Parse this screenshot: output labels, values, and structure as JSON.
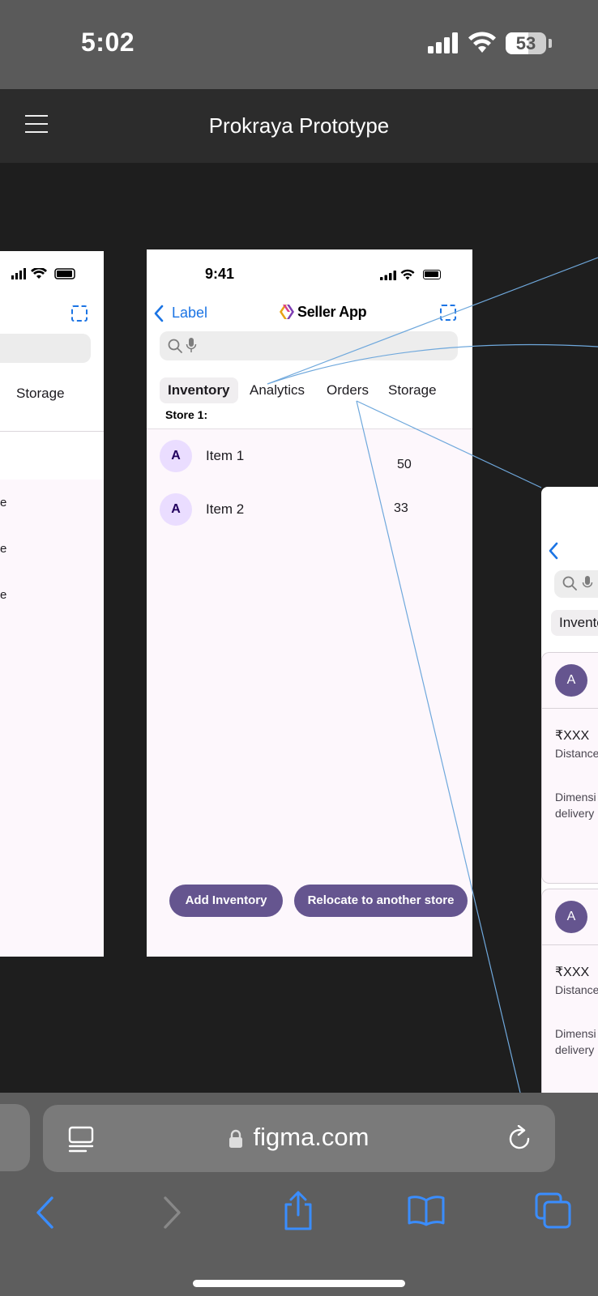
{
  "ios_status": {
    "time": "5:02",
    "battery": "53"
  },
  "figma": {
    "title": "Prokraya Prototype",
    "menu_icon": "hamburger-menu-icon"
  },
  "left_frame": {
    "tab_storage": "Storage",
    "row_fragments": [
      "e",
      "e",
      "e"
    ]
  },
  "center_frame": {
    "status_time": "9:41",
    "back_label": "Label",
    "app_title": "Seller App",
    "tabs": [
      "Inventory",
      "Analytics",
      "Orders",
      "Storage"
    ],
    "active_tab": "Inventory",
    "store_label": "Store 1:",
    "items": [
      {
        "avatar": "A",
        "name": "Item 1",
        "value": "50"
      },
      {
        "avatar": "A",
        "name": "Item 2",
        "value": "33"
      }
    ],
    "buttons": {
      "add_inventory": "Add Inventory",
      "relocate": "Relocate to another store"
    },
    "colors": {
      "accent": "#65558f",
      "link": "#1b74e4",
      "avatar_bg": "#eaddff",
      "surface": "#fdf7fc"
    }
  },
  "right_frame": {
    "tab_fragment": "Invento",
    "cards": [
      {
        "avatar": "A",
        "price": "₹XXX",
        "distance": "Distance",
        "dim1": "Dimensi",
        "dim2": "delivery"
      },
      {
        "avatar": "A",
        "price": "₹XXX",
        "distance": "Distance",
        "dim1": "Dimensi",
        "dim2": "delivery"
      }
    ]
  },
  "safari": {
    "url": "figma.com",
    "icons": [
      "reader-icon",
      "lock-icon",
      "reload-icon",
      "back-icon",
      "forward-icon",
      "share-icon",
      "bookmarks-icon",
      "tabs-icon"
    ]
  }
}
